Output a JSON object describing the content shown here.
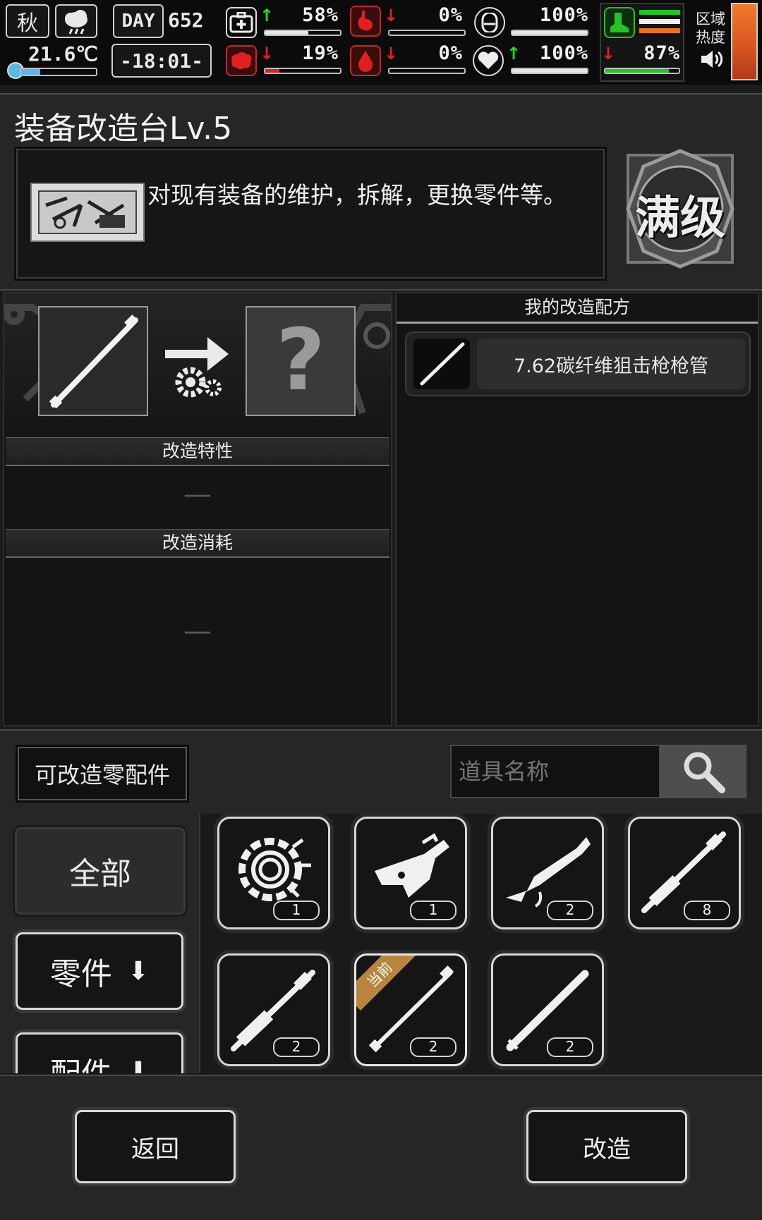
{
  "hud": {
    "season": "秋",
    "temperature": "21.6℃",
    "temperature_level": 0.25,
    "day_label": "DAY",
    "day_number": "652",
    "clock": "-18:01-",
    "stats": [
      {
        "name": "health-kit",
        "value": "58%",
        "trend": "up",
        "level": 0.58
      },
      {
        "name": "stomach",
        "value": "0%",
        "trend": "down",
        "level": 0.0
      },
      {
        "name": "bladder",
        "value": "100%",
        "trend": "none",
        "level": 1.0
      },
      {
        "name": "brain",
        "value": "19%",
        "trend": "down",
        "level": 0.19
      },
      {
        "name": "blood",
        "value": "0%",
        "trend": "down",
        "level": 0.0
      },
      {
        "name": "heart",
        "value": "100%",
        "trend": "up",
        "level": 1.0
      },
      {
        "name": "stamina",
        "value": "87%",
        "trend": "down",
        "level": 0.87
      }
    ],
    "region_heat_label": "区域\n热度",
    "colors": {
      "up": "#22dd22",
      "down": "#e02020",
      "red_bar": "#e02020",
      "green_bar": "#27c227"
    }
  },
  "station": {
    "title": "装备改造台Lv.5",
    "description": "对现有装备的维护，拆解，更换零件等。",
    "badge": "满级"
  },
  "modify": {
    "traits_label": "改造特性",
    "traits_value": "—",
    "cost_label": "改造消耗",
    "cost_value": "—",
    "result_placeholder": "?"
  },
  "recipes": {
    "header": "我的改造配方",
    "items": [
      {
        "name": "7.62碳纤维狙击枪枪管"
      }
    ]
  },
  "parts": {
    "filter_label": "可改造零配件",
    "search_placeholder": "道具名称",
    "categories": [
      {
        "label": "全部"
      },
      {
        "label": "零件"
      },
      {
        "label": "配件"
      }
    ],
    "items": [
      {
        "icon": "gear-ring-icon",
        "qty": "1"
      },
      {
        "icon": "trigger-assembly-icon",
        "qty": "1"
      },
      {
        "icon": "rifle-receiver-icon",
        "qty": "2"
      },
      {
        "icon": "barrel-long-icon",
        "qty": "8"
      },
      {
        "icon": "barrel-short-icon",
        "qty": "2"
      },
      {
        "icon": "barrel-thin-icon",
        "qty": "2",
        "current": "当前"
      },
      {
        "icon": "barrel-plain-icon",
        "qty": "2"
      }
    ]
  },
  "actions": {
    "back": "返回",
    "modify": "改造"
  }
}
